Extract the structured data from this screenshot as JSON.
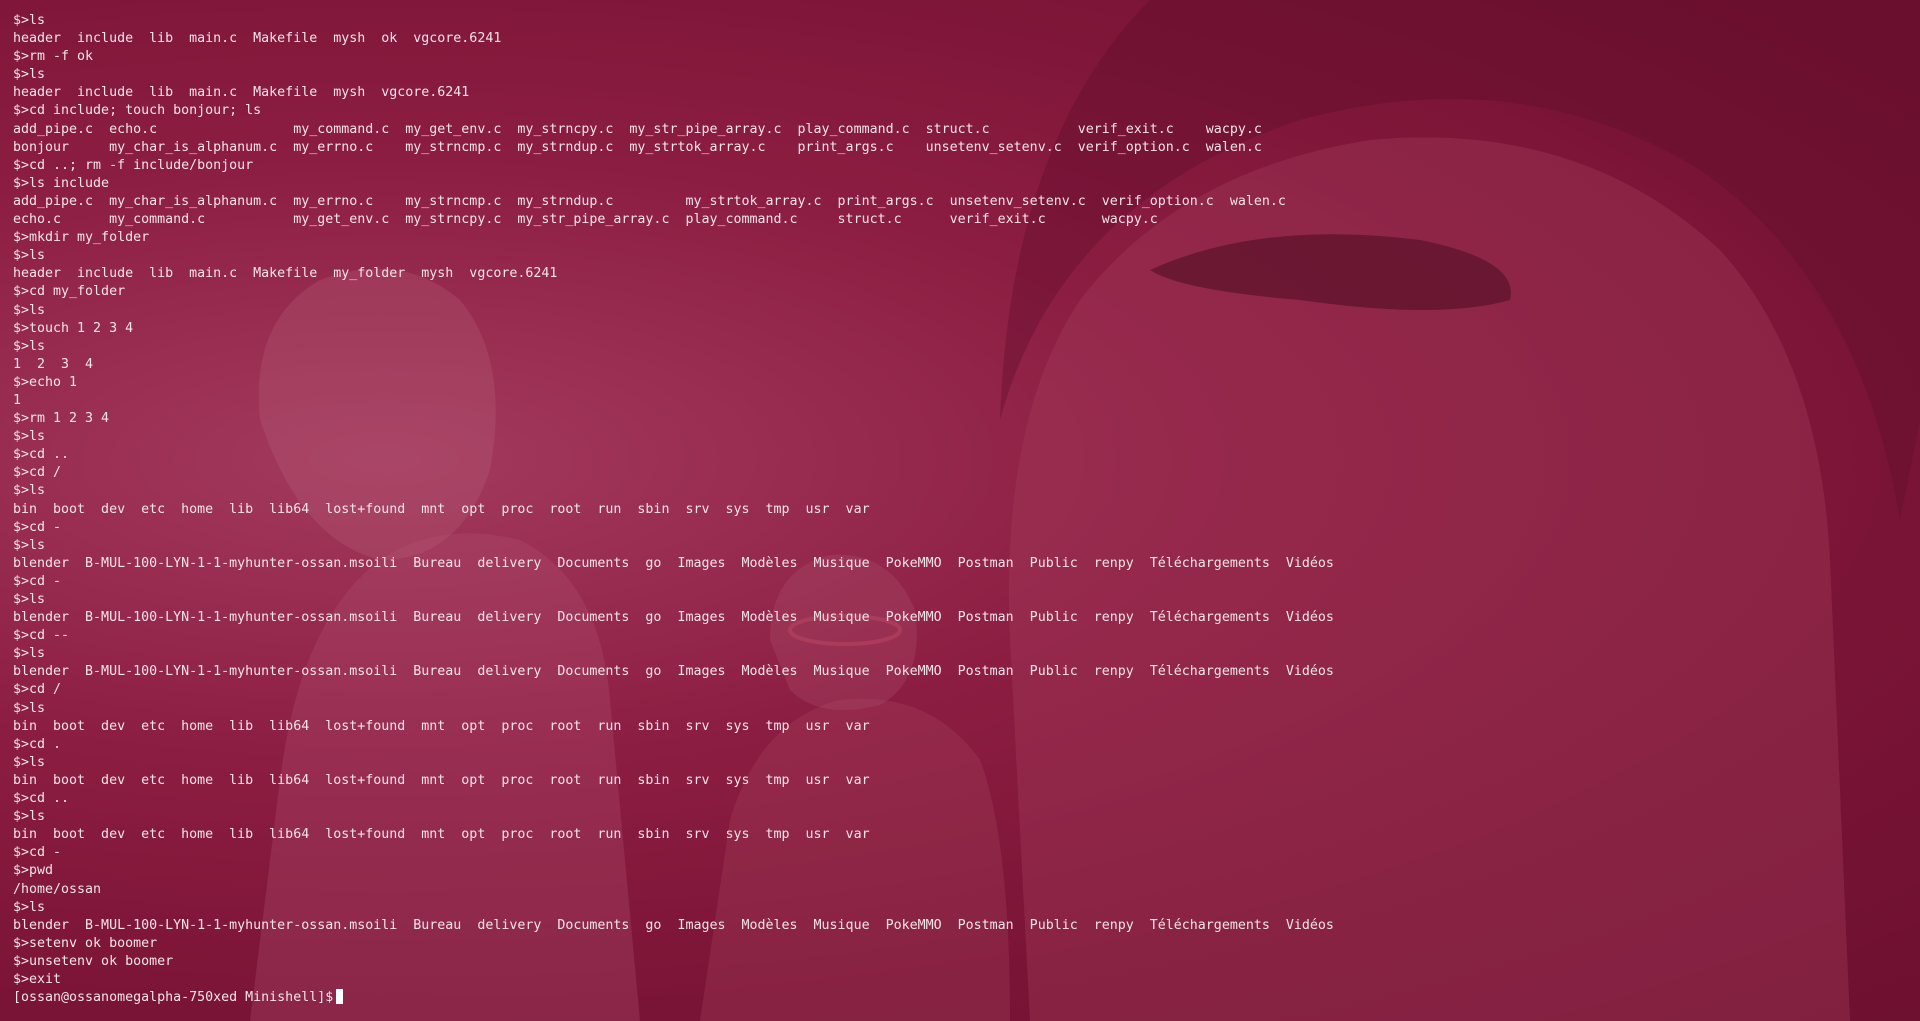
{
  "terminal": {
    "lines": [
      "$>ls",
      "header  include  lib  main.c  Makefile  mysh  ok  vgcore.6241",
      "$>rm -f ok",
      "$>ls",
      "header  include  lib  main.c  Makefile  mysh  vgcore.6241",
      "$>cd include; touch bonjour; ls",
      "add_pipe.c  echo.c                 my_command.c  my_get_env.c  my_strncpy.c  my_str_pipe_array.c  play_command.c  struct.c           verif_exit.c    wacpy.c",
      "bonjour     my_char_is_alphanum.c  my_errno.c    my_strncmp.c  my_strndup.c  my_strtok_array.c    print_args.c    unsetenv_setenv.c  verif_option.c  walen.c",
      "$>cd ..; rm -f include/bonjour",
      "$>ls include",
      "add_pipe.c  my_char_is_alphanum.c  my_errno.c    my_strncmp.c  my_strndup.c         my_strtok_array.c  print_args.c  unsetenv_setenv.c  verif_option.c  walen.c",
      "echo.c      my_command.c           my_get_env.c  my_strncpy.c  my_str_pipe_array.c  play_command.c     struct.c      verif_exit.c       wacpy.c",
      "$>mkdir my_folder",
      "$>ls",
      "header  include  lib  main.c  Makefile  my_folder  mysh  vgcore.6241",
      "$>cd my_folder",
      "$>ls",
      "$>touch 1 2 3 4",
      "$>ls",
      "1  2  3  4",
      "$>echo 1",
      "1",
      "$>rm 1 2 3 4",
      "$>ls",
      "$>cd ..",
      "$>cd /",
      "$>ls",
      "bin  boot  dev  etc  home  lib  lib64  lost+found  mnt  opt  proc  root  run  sbin  srv  sys  tmp  usr  var",
      "$>cd -",
      "$>ls",
      "blender  B-MUL-100-LYN-1-1-myhunter-ossan.msoili  Bureau  delivery  Documents  go  Images  Modèles  Musique  PokeMMO  Postman  Public  renpy  Téléchargements  Vidéos",
      "$>cd -",
      "$>ls",
      "blender  B-MUL-100-LYN-1-1-myhunter-ossan.msoili  Bureau  delivery  Documents  go  Images  Modèles  Musique  PokeMMO  Postman  Public  renpy  Téléchargements  Vidéos",
      "$>cd --",
      "$>ls",
      "blender  B-MUL-100-LYN-1-1-myhunter-ossan.msoili  Bureau  delivery  Documents  go  Images  Modèles  Musique  PokeMMO  Postman  Public  renpy  Téléchargements  Vidéos",
      "$>cd /",
      "$>ls",
      "bin  boot  dev  etc  home  lib  lib64  lost+found  mnt  opt  proc  root  run  sbin  srv  sys  tmp  usr  var",
      "$>cd .",
      "$>ls",
      "bin  boot  dev  etc  home  lib  lib64  lost+found  mnt  opt  proc  root  run  sbin  srv  sys  tmp  usr  var",
      "$>cd ..",
      "$>ls",
      "bin  boot  dev  etc  home  lib  lib64  lost+found  mnt  opt  proc  root  run  sbin  srv  sys  tmp  usr  var",
      "$>cd -",
      "$>pwd",
      "/home/ossan",
      "$>ls",
      "blender  B-MUL-100-LYN-1-1-myhunter-ossan.msoili  Bureau  delivery  Documents  go  Images  Modèles  Musique  PokeMMO  Postman  Public  renpy  Téléchargements  Vidéos",
      "$>setenv ok boomer",
      "$>unsetenv ok boomer",
      "$>exit"
    ],
    "prompt": "[ossan@ossanomegalpha-750xed Minishell]$ "
  },
  "colors": {
    "background": "#8c1d42",
    "text": "#f3e4ea",
    "cursor": "#ffffff"
  }
}
